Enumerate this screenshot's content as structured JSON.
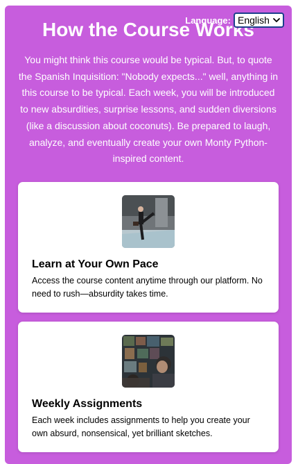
{
  "header": {
    "title": "How the Course Works",
    "language_label": "Language:",
    "language_selected": "English"
  },
  "intro_text": "You might think this course would be typical. But, to quote the Spanish Inquisition: \"Nobody expects...\" well, anything in this course to be typical. Each week, you will be introduced to new absurdities, surprise lessons, and sudden diversions (like a discussion about coconuts). Be prepared to laugh, analyze, and eventually create your own Monty Python-inspired content.",
  "cards": [
    {
      "title": "Learn at Your Own Pace",
      "text": "Access the course content anytime through our platform. No need to rush—absurdity takes time."
    },
    {
      "title": "Weekly Assignments",
      "text": "Each week includes assignments to help you create your own absurd, nonsensical, yet brilliant sketches."
    }
  ],
  "colors": {
    "background": "#c75ddd",
    "card": "#ffffff",
    "select_border": "#1b3f8c"
  }
}
